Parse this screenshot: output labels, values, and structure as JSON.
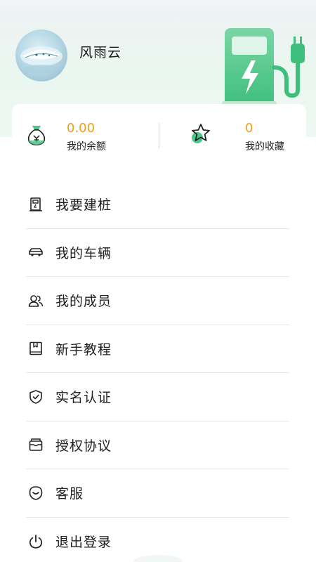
{
  "profile": {
    "username": "风雨云"
  },
  "stats": {
    "balance": {
      "value": "0.00",
      "label": "我的余额"
    },
    "favorites": {
      "value": "0",
      "label": "我的收藏"
    }
  },
  "menu": {
    "items": [
      {
        "label": "我要建桩",
        "icon": "charging-station-icon"
      },
      {
        "label": "我的车辆",
        "icon": "car-icon"
      },
      {
        "label": "我的成员",
        "icon": "members-icon"
      },
      {
        "label": "新手教程",
        "icon": "book-icon"
      },
      {
        "label": "实名认证",
        "icon": "shield-check-icon"
      },
      {
        "label": "授权协议",
        "icon": "agreement-icon"
      },
      {
        "label": "客服",
        "icon": "customer-service-icon"
      },
      {
        "label": "退出登录",
        "icon": "power-icon"
      }
    ]
  },
  "colors": {
    "accent_green": "#4cc68a",
    "value_orange": "#f0a017"
  }
}
